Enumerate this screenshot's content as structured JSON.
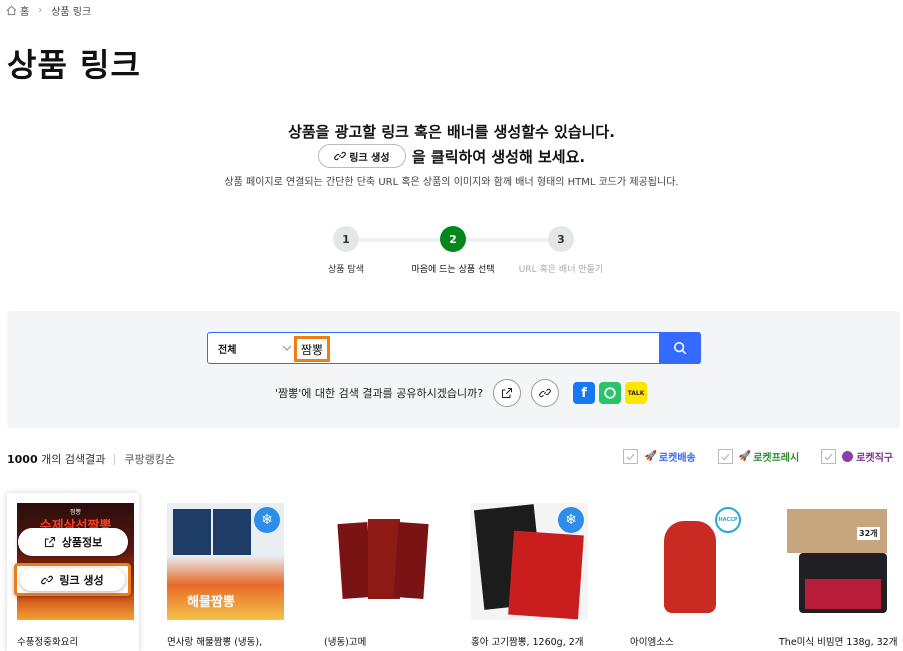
{
  "breadcrumb": {
    "home": "홈",
    "current": "상품 링크"
  },
  "page_title": "상품 링크",
  "intro": {
    "line1": "상품을 광고할 링크 혹은 배너를 생성할수 있습니다.",
    "inline_button": "링크 생성",
    "line2_suffix": "을 클릭하여 생성해 보세요.",
    "description": "상품 페이지로 연결되는 간단한 단축 URL 혹은 상품의 이미지와 함께 배너 형태의 HTML 코드가 제공됩니다."
  },
  "steps": [
    {
      "number": "1",
      "label": "상품 탐색",
      "state": "done"
    },
    {
      "number": "2",
      "label": "마음에 드는 상품 선택",
      "state": "active"
    },
    {
      "number": "3",
      "label": "URL 혹은 배너 만들기",
      "state": "pending"
    }
  ],
  "search": {
    "category": "전체",
    "query": "짬뽕",
    "share_prompt": "'짬뽕'에 대한 검색 결과를 공유하시겠습니까?"
  },
  "results": {
    "count": "1000",
    "count_suffix": " 개의 검색결과",
    "sort": "쿠팡랭킹순",
    "filters": [
      "로켓배송",
      "로켓프레시",
      "로켓직구"
    ]
  },
  "colors": {
    "accent_blue": "#346aff",
    "active_step": "#00891a",
    "highlight": "#f07c15"
  },
  "hover_actions": {
    "info": "상품정보",
    "link": "링크 생성"
  },
  "products": [
    {
      "title": "수풍정중화요리",
      "image_text": "수제삼선짬뽕"
    },
    {
      "title": "면사랑 해물짬뽕 (냉동),",
      "image_text": "해물짬뽕",
      "badge": "냉동"
    },
    {
      "title": "(냉동)고메",
      "image_text": ""
    },
    {
      "title": "홍아 고기짬뽕, 1260g, 2개",
      "image_text": "",
      "badge": "냉동"
    },
    {
      "title": "아이엠소스",
      "image_text": "HACCP"
    },
    {
      "title": "The미식 비빔면 138g, 32개",
      "image_text": "32개"
    }
  ]
}
